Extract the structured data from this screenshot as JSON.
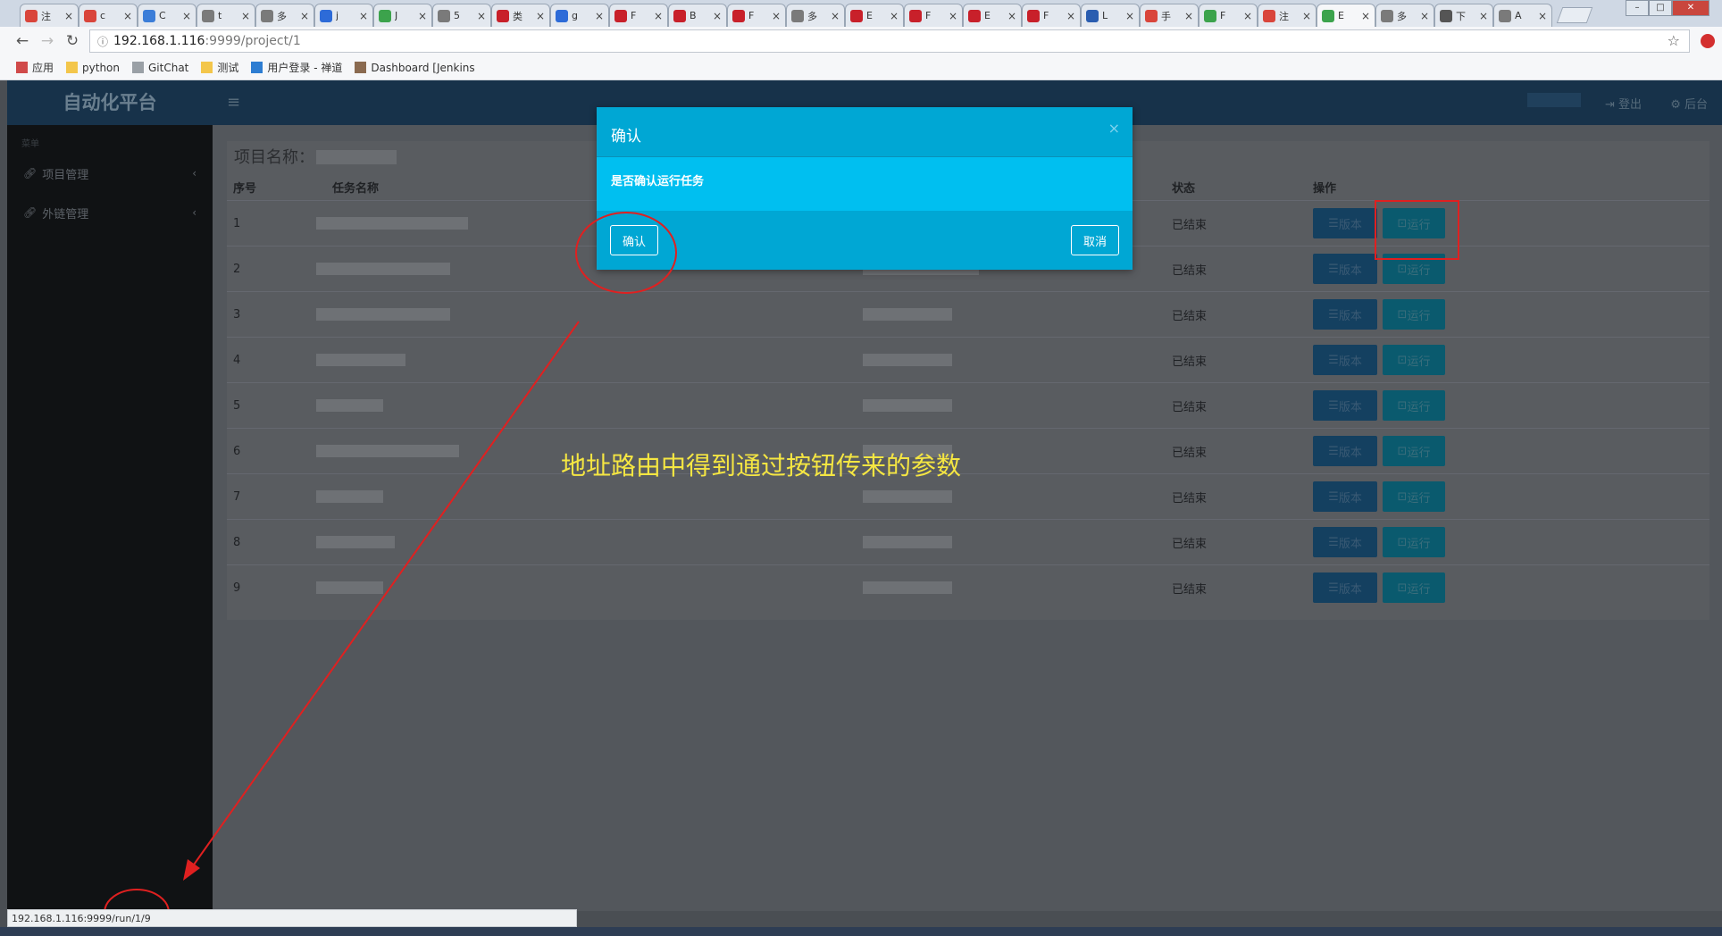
{
  "browser": {
    "tabs": [
      {
        "label": "注",
        "color": "#d9453b"
      },
      {
        "label": "c",
        "color": "#d9453b"
      },
      {
        "label": "C",
        "color": "#3b7dd8"
      },
      {
        "label": "t",
        "color": "#7a7a7a"
      },
      {
        "label": "多",
        "color": "#7a7a7a"
      },
      {
        "label": "j",
        "color": "#2d6bd8"
      },
      {
        "label": "J",
        "color": "#3ca34c"
      },
      {
        "label": "5",
        "color": "#7a7a7a"
      },
      {
        "label": "类",
        "color": "#c8202a"
      },
      {
        "label": "g",
        "color": "#2d6bd8"
      },
      {
        "label": "F",
        "color": "#c8202a"
      },
      {
        "label": "B",
        "color": "#c8202a"
      },
      {
        "label": "F",
        "color": "#c8202a"
      },
      {
        "label": "多",
        "color": "#7a7a7a"
      },
      {
        "label": "E",
        "color": "#c8202a"
      },
      {
        "label": "F",
        "color": "#c8202a"
      },
      {
        "label": "E",
        "color": "#c8202a"
      },
      {
        "label": "F",
        "color": "#c8202a"
      },
      {
        "label": "L",
        "color": "#2a5db0"
      },
      {
        "label": "手",
        "color": "#d9453b"
      },
      {
        "label": "F",
        "color": "#3ca34c"
      },
      {
        "label": "注",
        "color": "#d9453b"
      },
      {
        "label": "E",
        "color": "#3ca34c",
        "active": true
      },
      {
        "label": "多",
        "color": "#7a7a7a"
      },
      {
        "label": "下",
        "color": "#555555"
      },
      {
        "label": "A",
        "color": "#7a7a7a"
      }
    ],
    "url_host": "192.168.1.116",
    "url_path": ":9999/project/1",
    "bookmarks": [
      {
        "label": "应用",
        "icon": "apps-grid-icon",
        "color": "#d04a4a"
      },
      {
        "label": "python",
        "icon": "folder-icon",
        "color": "#f3c64b"
      },
      {
        "label": "GitChat",
        "icon": "page-icon",
        "color": "#9aa0a6"
      },
      {
        "label": "测试",
        "icon": "folder-icon",
        "color": "#f3c64b"
      },
      {
        "label": "用户登录 - 禅道",
        "icon": "globe-icon",
        "color": "#2d7dd2"
      },
      {
        "label": "Dashboard [Jenkins",
        "icon": "jenkins-icon",
        "color": "#8a6a50"
      }
    ],
    "status_url": "192.168.1.116:9999/run/1/9"
  },
  "app": {
    "brand": "自动化平台",
    "menu_heading": "菜单",
    "menu": [
      {
        "label": "项目管理"
      },
      {
        "label": "外链管理"
      }
    ],
    "logout": "登出",
    "admin": "后台",
    "project_label": "项目名称："
  },
  "table": {
    "headers": {
      "no": "序号",
      "name": "任务名称",
      "status": "状态",
      "ops": "操作"
    },
    "rows": [
      {
        "no": "1",
        "status": "已结束"
      },
      {
        "no": "2",
        "status": "已结束"
      },
      {
        "no": "3",
        "status": "已结束"
      },
      {
        "no": "4",
        "status": "已结束"
      },
      {
        "no": "5",
        "status": "已结束"
      },
      {
        "no": "6",
        "status": "已结束"
      },
      {
        "no": "7",
        "status": "已结束"
      },
      {
        "no": "8",
        "status": "已结束"
      },
      {
        "no": "9",
        "status": "已结束"
      }
    ],
    "btn_version": "版本",
    "btn_run": "运行"
  },
  "modal": {
    "title": "确认",
    "message": "是否确认运行任务",
    "ok": "确认",
    "cancel": "取消",
    "close": "×"
  },
  "annotation": {
    "text": "地址路由中得到通过按钮传来的参数",
    "color": "#f5e642",
    "mark_color": "#e02020"
  }
}
